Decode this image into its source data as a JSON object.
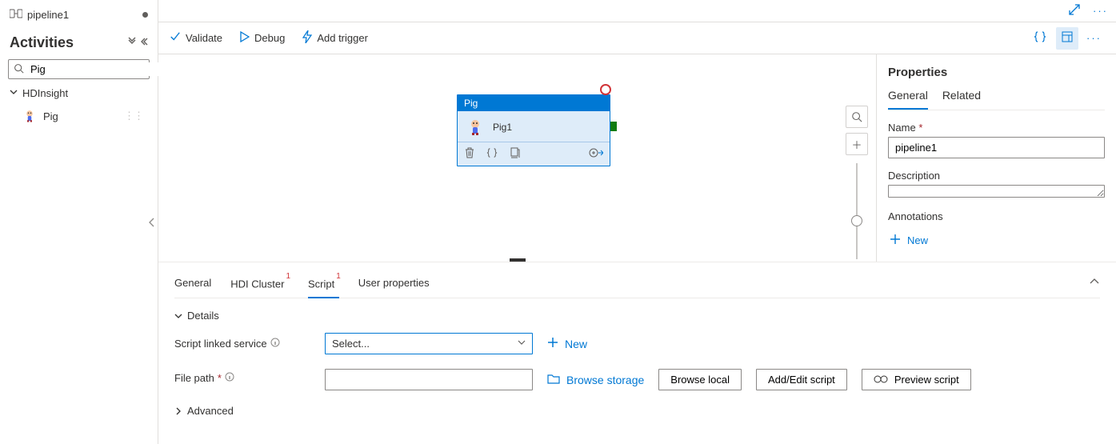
{
  "tab": {
    "name": "pipeline1",
    "dirty": true
  },
  "sidebar": {
    "title": "Activities",
    "search_value": "Pig",
    "category": "HDInsight",
    "items": [
      {
        "label": "Pig"
      }
    ]
  },
  "toolbar": {
    "validate": "Validate",
    "debug": "Debug",
    "add_trigger": "Add trigger"
  },
  "canvas": {
    "node": {
      "type": "Pig",
      "name": "Pig1"
    }
  },
  "config": {
    "tabs": {
      "general": "General",
      "hdi": "HDI Cluster",
      "hdi_badge": "1",
      "script": "Script",
      "script_badge": "1",
      "user_props": "User properties"
    },
    "details_section": "Details",
    "script_linked_label": "Script linked service",
    "select_placeholder": "Select...",
    "new_link": "New",
    "file_path_label": "File path",
    "browse_storage": "Browse storage",
    "browse_local": "Browse local",
    "add_edit": "Add/Edit script",
    "preview": "Preview script",
    "advanced_section": "Advanced"
  },
  "props": {
    "title": "Properties",
    "tabs": {
      "general": "General",
      "related": "Related"
    },
    "name_label": "Name",
    "name_value": "pipeline1",
    "desc_label": "Description",
    "desc_value": "",
    "annotations_label": "Annotations",
    "new_annotation": "New"
  }
}
